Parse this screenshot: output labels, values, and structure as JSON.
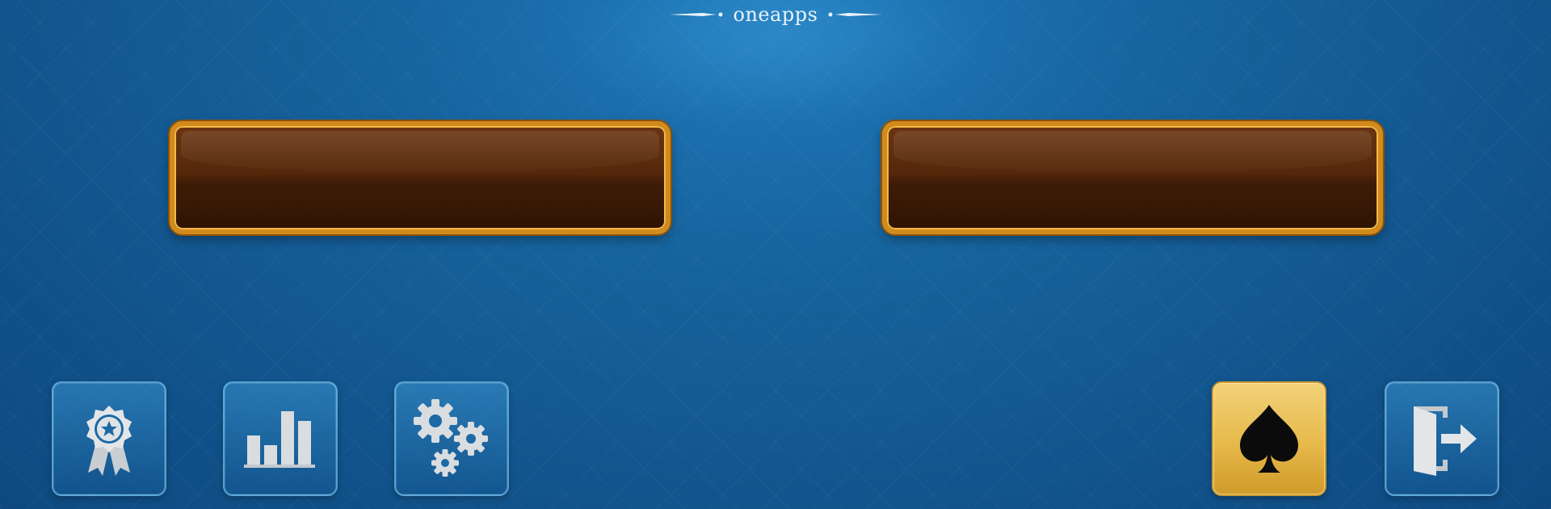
{
  "brand": {
    "name": "oneapps"
  },
  "main_buttons": [
    {
      "label": ""
    },
    {
      "label": ""
    }
  ],
  "toolbar": {
    "left": [
      {
        "icon": "award-ribbon-icon"
      },
      {
        "icon": "bar-chart-icon"
      },
      {
        "icon": "gears-icon"
      }
    ],
    "right": [
      {
        "icon": "spade-icon",
        "active": true
      },
      {
        "icon": "exit-door-icon"
      }
    ]
  },
  "colors": {
    "background": "#155f9c",
    "wood_button_fill": "#4a220a",
    "wood_button_border": "#d18b1c",
    "tile_border": "#78c8f0",
    "active_tile_gold": "#e6b94a",
    "icon_silver": "#d9dde0"
  }
}
